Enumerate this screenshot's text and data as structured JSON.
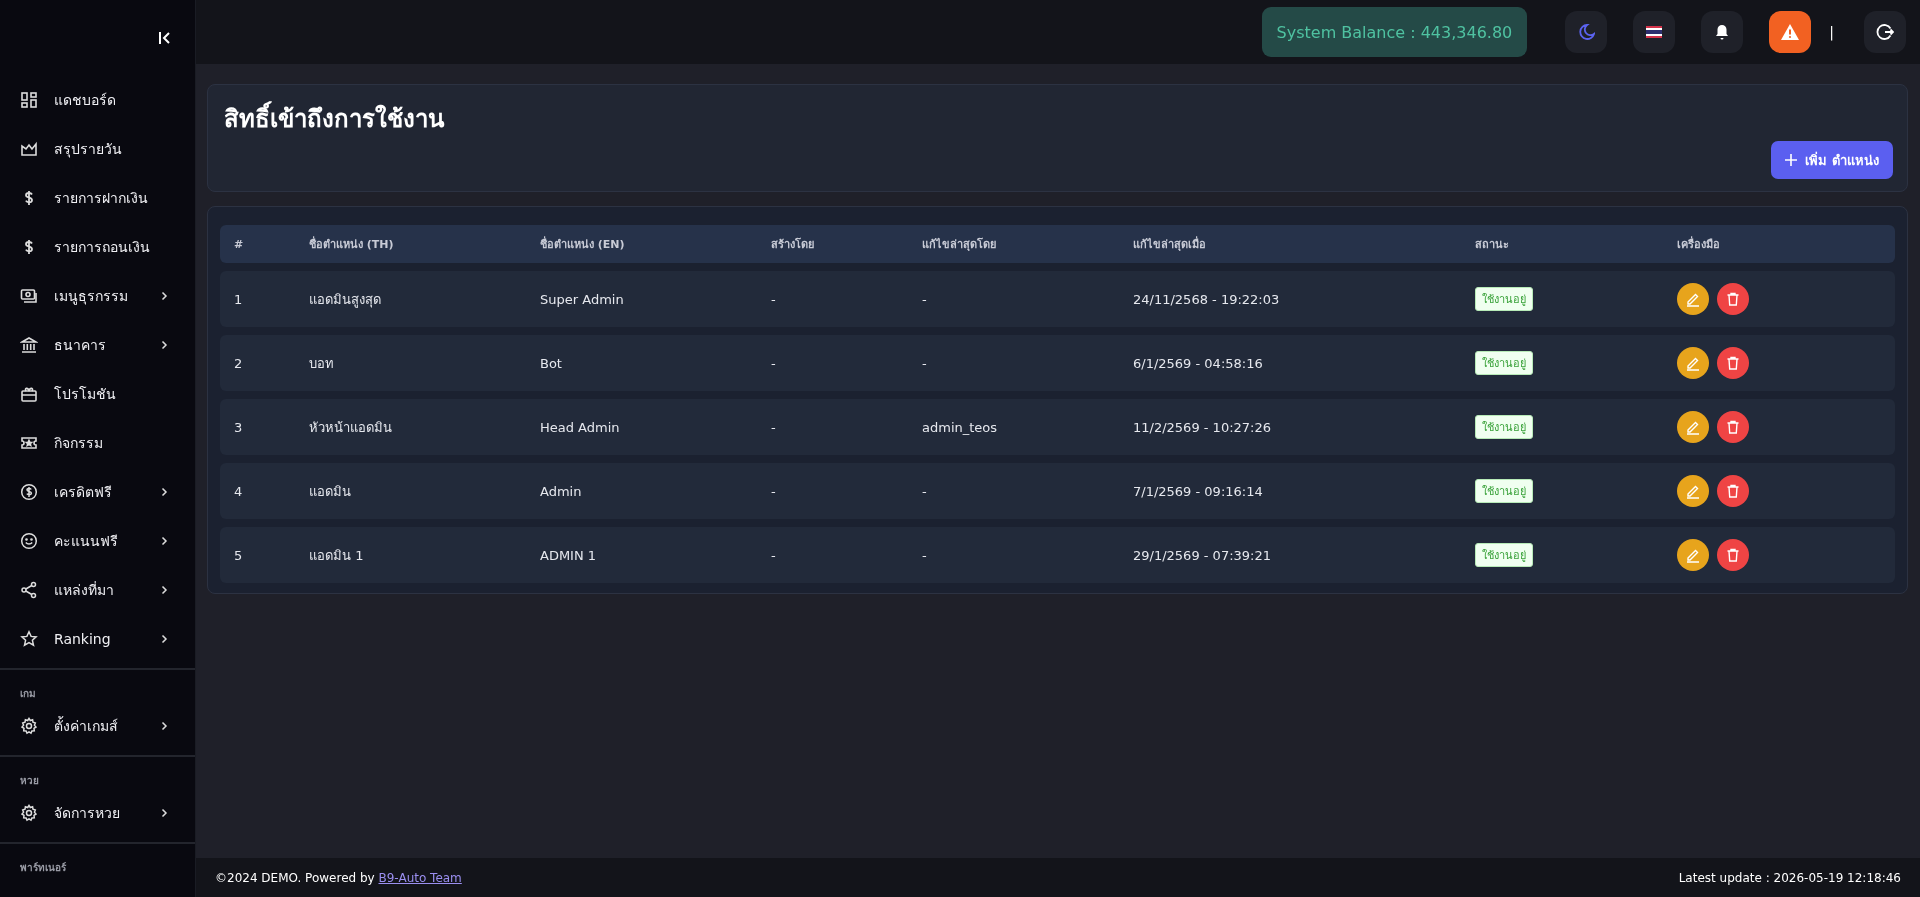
{
  "sidebar": {
    "sections": [
      {
        "items": [
          {
            "label": "แดชบอร์ด",
            "expandable": false
          },
          {
            "label": "สรุปรายวัน",
            "expandable": false
          },
          {
            "label": "รายการฝากเงิน",
            "expandable": false
          },
          {
            "label": "รายการถอนเงิน",
            "expandable": false
          },
          {
            "label": "เมนูธุรกรรม",
            "expandable": true
          },
          {
            "label": "ธนาคาร",
            "expandable": true
          },
          {
            "label": "โปรโมชัน",
            "expandable": false
          },
          {
            "label": "กิจกรรม",
            "expandable": false
          },
          {
            "label": "เครดิตฟรี",
            "expandable": true
          },
          {
            "label": "คะแนนฟรี",
            "expandable": true
          },
          {
            "label": "แหล่งที่มา",
            "expandable": true
          },
          {
            "label": "Ranking",
            "expandable": true
          }
        ]
      },
      {
        "title": "เกม",
        "items": [
          {
            "label": "ตั้งค่าเกมส์",
            "expandable": true
          }
        ]
      },
      {
        "title": "หวย",
        "items": [
          {
            "label": "จัดการหวย",
            "expandable": true
          }
        ]
      },
      {
        "title": "พาร์ทเนอร์"
      }
    ]
  },
  "topbar": {
    "balance": "System Balance : 443,346.80",
    "separator": "|"
  },
  "page": {
    "title": "สิทธิ์เข้าถึงการใช้งาน",
    "add_button": "เพิ่ม ตำแหน่ง"
  },
  "table": {
    "columns": [
      "#",
      "ชื่อตำแหน่ง (TH)",
      "ชื่อตำแหน่ง (EN)",
      "สร้างโดย",
      "แก้ไขล่าสุดโดย",
      "แก้ไขล่าสุดเมื่อ",
      "สถานะ",
      "เครื่องมือ"
    ],
    "rows": [
      {
        "cells": [
          "1",
          "แอดมินสูงสุด",
          "Super Admin",
          "-",
          "-",
          "24/11/2568 - 19:22:03"
        ],
        "status": "ใช้งานอยู่",
        "active": true
      },
      {
        "cells": [
          "2",
          "บอท",
          "Bot",
          "-",
          "-",
          "6/1/2569 - 04:58:16"
        ],
        "status": "ใช้งานอยู่",
        "active": true
      },
      {
        "cells": [
          "3",
          "หัวหน้าแอดมิน",
          "Head Admin",
          "-",
          "admin_teos",
          "11/2/2569 - 10:27:26"
        ],
        "status": "ใช้งานอยู่",
        "active": true
      },
      {
        "cells": [
          "4",
          "แอดมิน",
          "Admin",
          "-",
          "-",
          "7/1/2569 - 09:16:14"
        ],
        "status": "ใช้งานอยู่",
        "active": true
      },
      {
        "cells": [
          "5",
          "แอดมิน 1",
          "ADMIN 1",
          "-",
          "-",
          "29/1/2569 - 07:39:21"
        ],
        "status": "ใช้งานอยู่",
        "active": true
      }
    ]
  },
  "footer": {
    "copyright": "©2024 DEMO. Powered by",
    "link": "B9-Auto Team",
    "update": "Latest update : 2026-05-19 12:18:46"
  }
}
